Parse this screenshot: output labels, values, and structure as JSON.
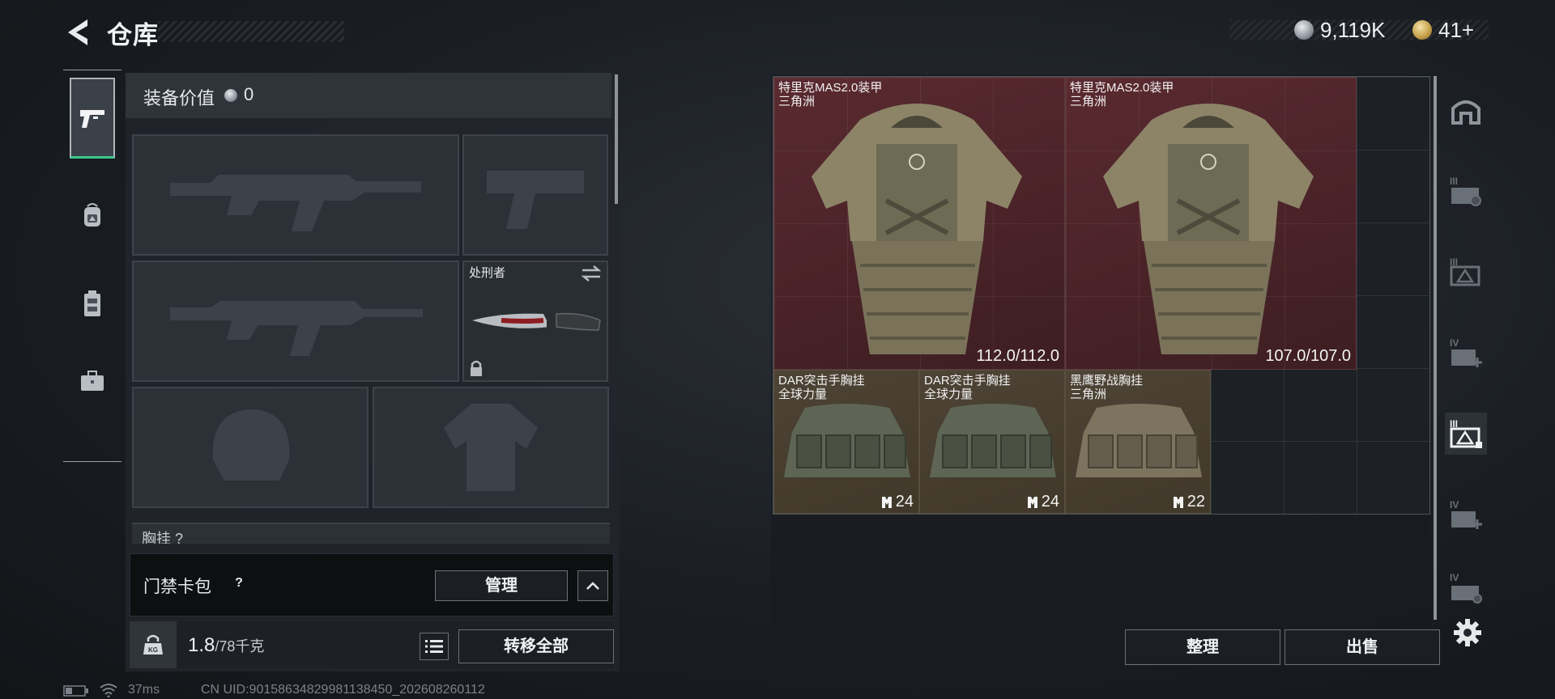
{
  "header": {
    "title": "仓库",
    "silver_amount": "9,119K",
    "gold_amount": "41+"
  },
  "loadout": {
    "gear_value_label": "装备价值",
    "gear_value": "0",
    "melee_name": "处刑者",
    "chest_rig_label": "胸挂 ?",
    "keycard_label": "门禁卡包",
    "keycard_help": "?",
    "manage_label": "管理",
    "weight_current": "1.8",
    "weight_max": "/78千克",
    "transfer_all_label": "转移全部"
  },
  "storage": {
    "items": [
      {
        "name_line1": "特里克MAS2.0装甲",
        "name_line2": "三角洲",
        "durability": "112.0/112.0"
      },
      {
        "name_line1": "特里克MAS2.0装甲",
        "name_line2": "三角洲",
        "durability": "107.0/107.0"
      },
      {
        "name_line1": "DAR突击手胸挂",
        "name_line2": "全球力量",
        "capacity": "24"
      },
      {
        "name_line1": "DAR突击手胸挂",
        "name_line2": "全球力量",
        "capacity": "24"
      },
      {
        "name_line1": "黑鹰野战胸挂",
        "name_line2": "三角洲",
        "capacity": "22"
      }
    ],
    "sort_label": "整理",
    "sell_label": "出售"
  },
  "status": {
    "ping": "37ms",
    "uid": "CN UID:90158634829981138450_202608260112"
  },
  "colors": {
    "armor_bg": "#4a2328",
    "rig_bg": "#403829",
    "active_tab_underline": "#37c98c"
  },
  "icons": {
    "rail": [
      "gun-icon",
      "backpack-icon",
      "chest-rig-icon",
      "case-icon"
    ],
    "containers": [
      "safe-box-icon",
      "container-iii-icon",
      "container-iii-triangle-icon",
      "container-iv-plus-icon",
      "container-iii-active-icon",
      "container-iv-plus-2-icon",
      "container-iv-icon",
      "gear-icon"
    ]
  }
}
